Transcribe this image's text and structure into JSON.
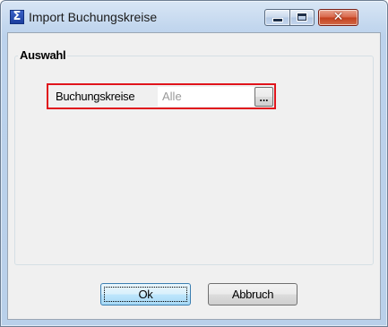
{
  "window": {
    "title": "Import Buchungskreise",
    "icon": "sigma-icon",
    "controls": {
      "minimize": "minimize-icon",
      "maximize": "maximize-icon",
      "close": "close-icon"
    }
  },
  "group": {
    "title": "Auswahl"
  },
  "field": {
    "label": "Buchungskreise",
    "value": "Alle",
    "browse_label": "..."
  },
  "buttons": {
    "ok_label": "Ok",
    "cancel_label": "Abbruch"
  },
  "colors": {
    "highlight_border": "#e0141c",
    "close_button": "#c2401e",
    "title_bar": "#c3d7ee"
  }
}
